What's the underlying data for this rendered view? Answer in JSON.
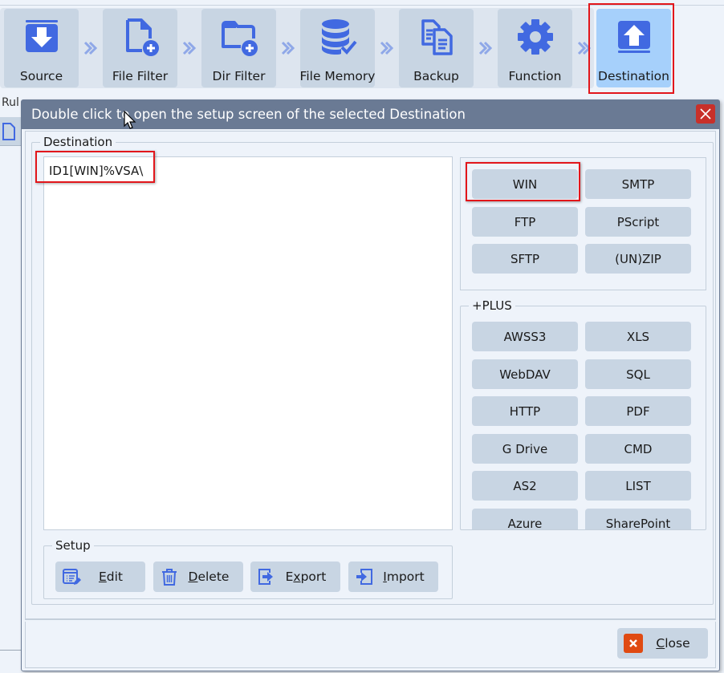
{
  "toolbar": {
    "steps": [
      {
        "label": "Source",
        "icon": "download-box-icon",
        "active": false
      },
      {
        "label": "File Filter",
        "icon": "file-add-icon",
        "active": false
      },
      {
        "label": "Dir Filter",
        "icon": "folder-add-icon",
        "active": false
      },
      {
        "label": "File Memory",
        "icon": "database-check-icon",
        "active": false
      },
      {
        "label": "Backup",
        "icon": "copy-documents-icon",
        "active": false
      },
      {
        "label": "Function",
        "icon": "gear-icon",
        "active": false
      },
      {
        "label": "Destination",
        "icon": "upload-box-icon",
        "active": true
      }
    ]
  },
  "background": {
    "rule_tab_label": "Rul"
  },
  "dialog": {
    "title": "Double click to open the setup screen of the selected Destination",
    "destination_group_label": "Destination",
    "destinations": [
      "ID1[WIN]%VSA\\"
    ],
    "types": [
      "WIN",
      "SMTP",
      "FTP",
      "PScript",
      "SFTP",
      "(UN)ZIP"
    ],
    "plus_group_label": "+PLUS",
    "plus_types": [
      "AWSS3",
      "XLS",
      "WebDAV",
      "SQL",
      "HTTP",
      "PDF",
      "G Drive",
      "CMD",
      "AS2",
      "LIST",
      "Azure",
      "SharePoint"
    ],
    "setup_group_label": "Setup",
    "setup_buttons": {
      "edit": {
        "mnemonic": "E",
        "rest": "dit"
      },
      "delete": {
        "mnemonic": "D",
        "rest": "elete"
      },
      "export": {
        "pre": "E",
        "mnemonic": "x",
        "rest": "port"
      },
      "import": {
        "mnemonic": "I",
        "rest": "mport"
      }
    },
    "close": {
      "mnemonic": "C",
      "rest": "lose"
    }
  },
  "colors": {
    "accent_blue": "#4169e1",
    "highlight_red": "#e2161b",
    "title_bar": "#6a7a94",
    "button_bg": "#c8d5e3",
    "active_step": "#a6d0fb"
  }
}
